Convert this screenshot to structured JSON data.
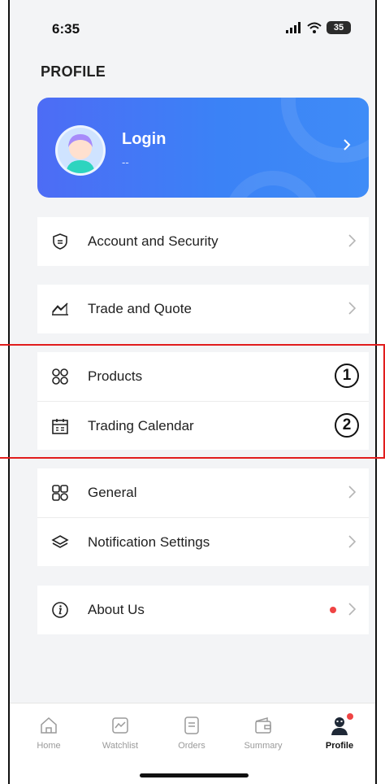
{
  "status_bar": {
    "time": "6:35",
    "battery": "35"
  },
  "page": {
    "title": "PROFILE"
  },
  "login_card": {
    "title": "Login",
    "subtitle": "--",
    "gradient_start": "#4d6cf5",
    "gradient_end": "#3f8cf7"
  },
  "groups": [
    {
      "items": [
        {
          "label": "Account and Security",
          "icon": "shield-icon"
        }
      ]
    },
    {
      "items": [
        {
          "label": "Trade and Quote",
          "icon": "trend-chart-icon"
        }
      ]
    },
    {
      "items": [
        {
          "label": "Products",
          "icon": "clover-icon",
          "mark": "1"
        },
        {
          "label": "Trading Calendar",
          "icon": "calendar-icon",
          "mark": "2"
        }
      ]
    },
    {
      "items": [
        {
          "label": "General",
          "icon": "grid-icon"
        },
        {
          "label": "Notification Settings",
          "icon": "layers-icon"
        }
      ]
    },
    {
      "items": [
        {
          "label": "About Us",
          "icon": "info-icon",
          "badge_color": "#ef4444"
        }
      ]
    }
  ],
  "tabs": [
    {
      "label": "Home",
      "icon": "home-icon"
    },
    {
      "label": "Watchlist",
      "icon": "watchlist-icon"
    },
    {
      "label": "Orders",
      "icon": "orders-icon"
    },
    {
      "label": "Summary",
      "icon": "wallet-icon"
    },
    {
      "label": "Profile",
      "icon": "profile-icon",
      "active": true
    }
  ],
  "colors": {
    "highlight": "#e11d1d",
    "accent": "#3b82f6",
    "badge": "#ef4444"
  }
}
